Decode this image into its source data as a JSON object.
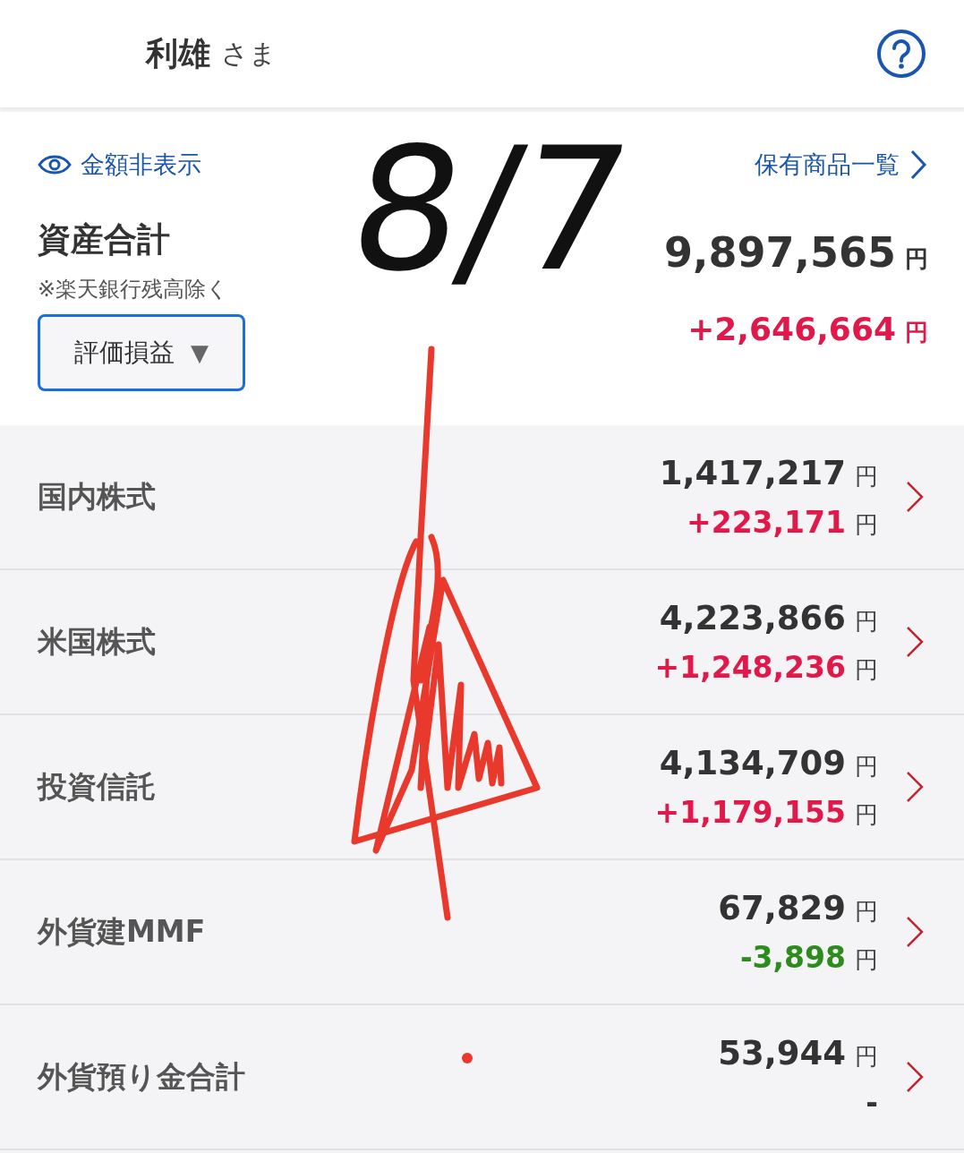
{
  "header": {
    "name": "利雄",
    "honorific": "さま"
  },
  "summary": {
    "hide_link": "金額非表示",
    "holdings_link": "保有商品一覧",
    "title": "資産合計",
    "note": "※楽天銀行残高除く",
    "dropdown": {
      "value": "評価損益",
      "caret": "▼"
    },
    "total": "9,897,565",
    "total_unit": "円",
    "change": "+2,646,664",
    "change_unit": "円",
    "kind": "gain"
  },
  "categories": [
    {
      "name": "国内株式",
      "value": "1,417,217",
      "value_unit": "円",
      "change": "+223,171",
      "change_unit": "円",
      "kind": "gain"
    },
    {
      "name": "米国株式",
      "value": "4,223,866",
      "value_unit": "円",
      "change": "+1,248,236",
      "change_unit": "円",
      "kind": "gain"
    },
    {
      "name": "投資信託",
      "value": "4,134,709",
      "value_unit": "円",
      "change": "+1,179,155",
      "change_unit": "円",
      "kind": "gain"
    },
    {
      "name": "外貨建MMF",
      "value": "67,829",
      "value_unit": "円",
      "change": "-3,898",
      "change_unit": "円",
      "kind": "loss"
    },
    {
      "name": "外貨預り金合計",
      "value": "53,944",
      "value_unit": "円",
      "change": "-",
      "kind": "none"
    }
  ],
  "annotation": {
    "text": "8/7"
  }
}
